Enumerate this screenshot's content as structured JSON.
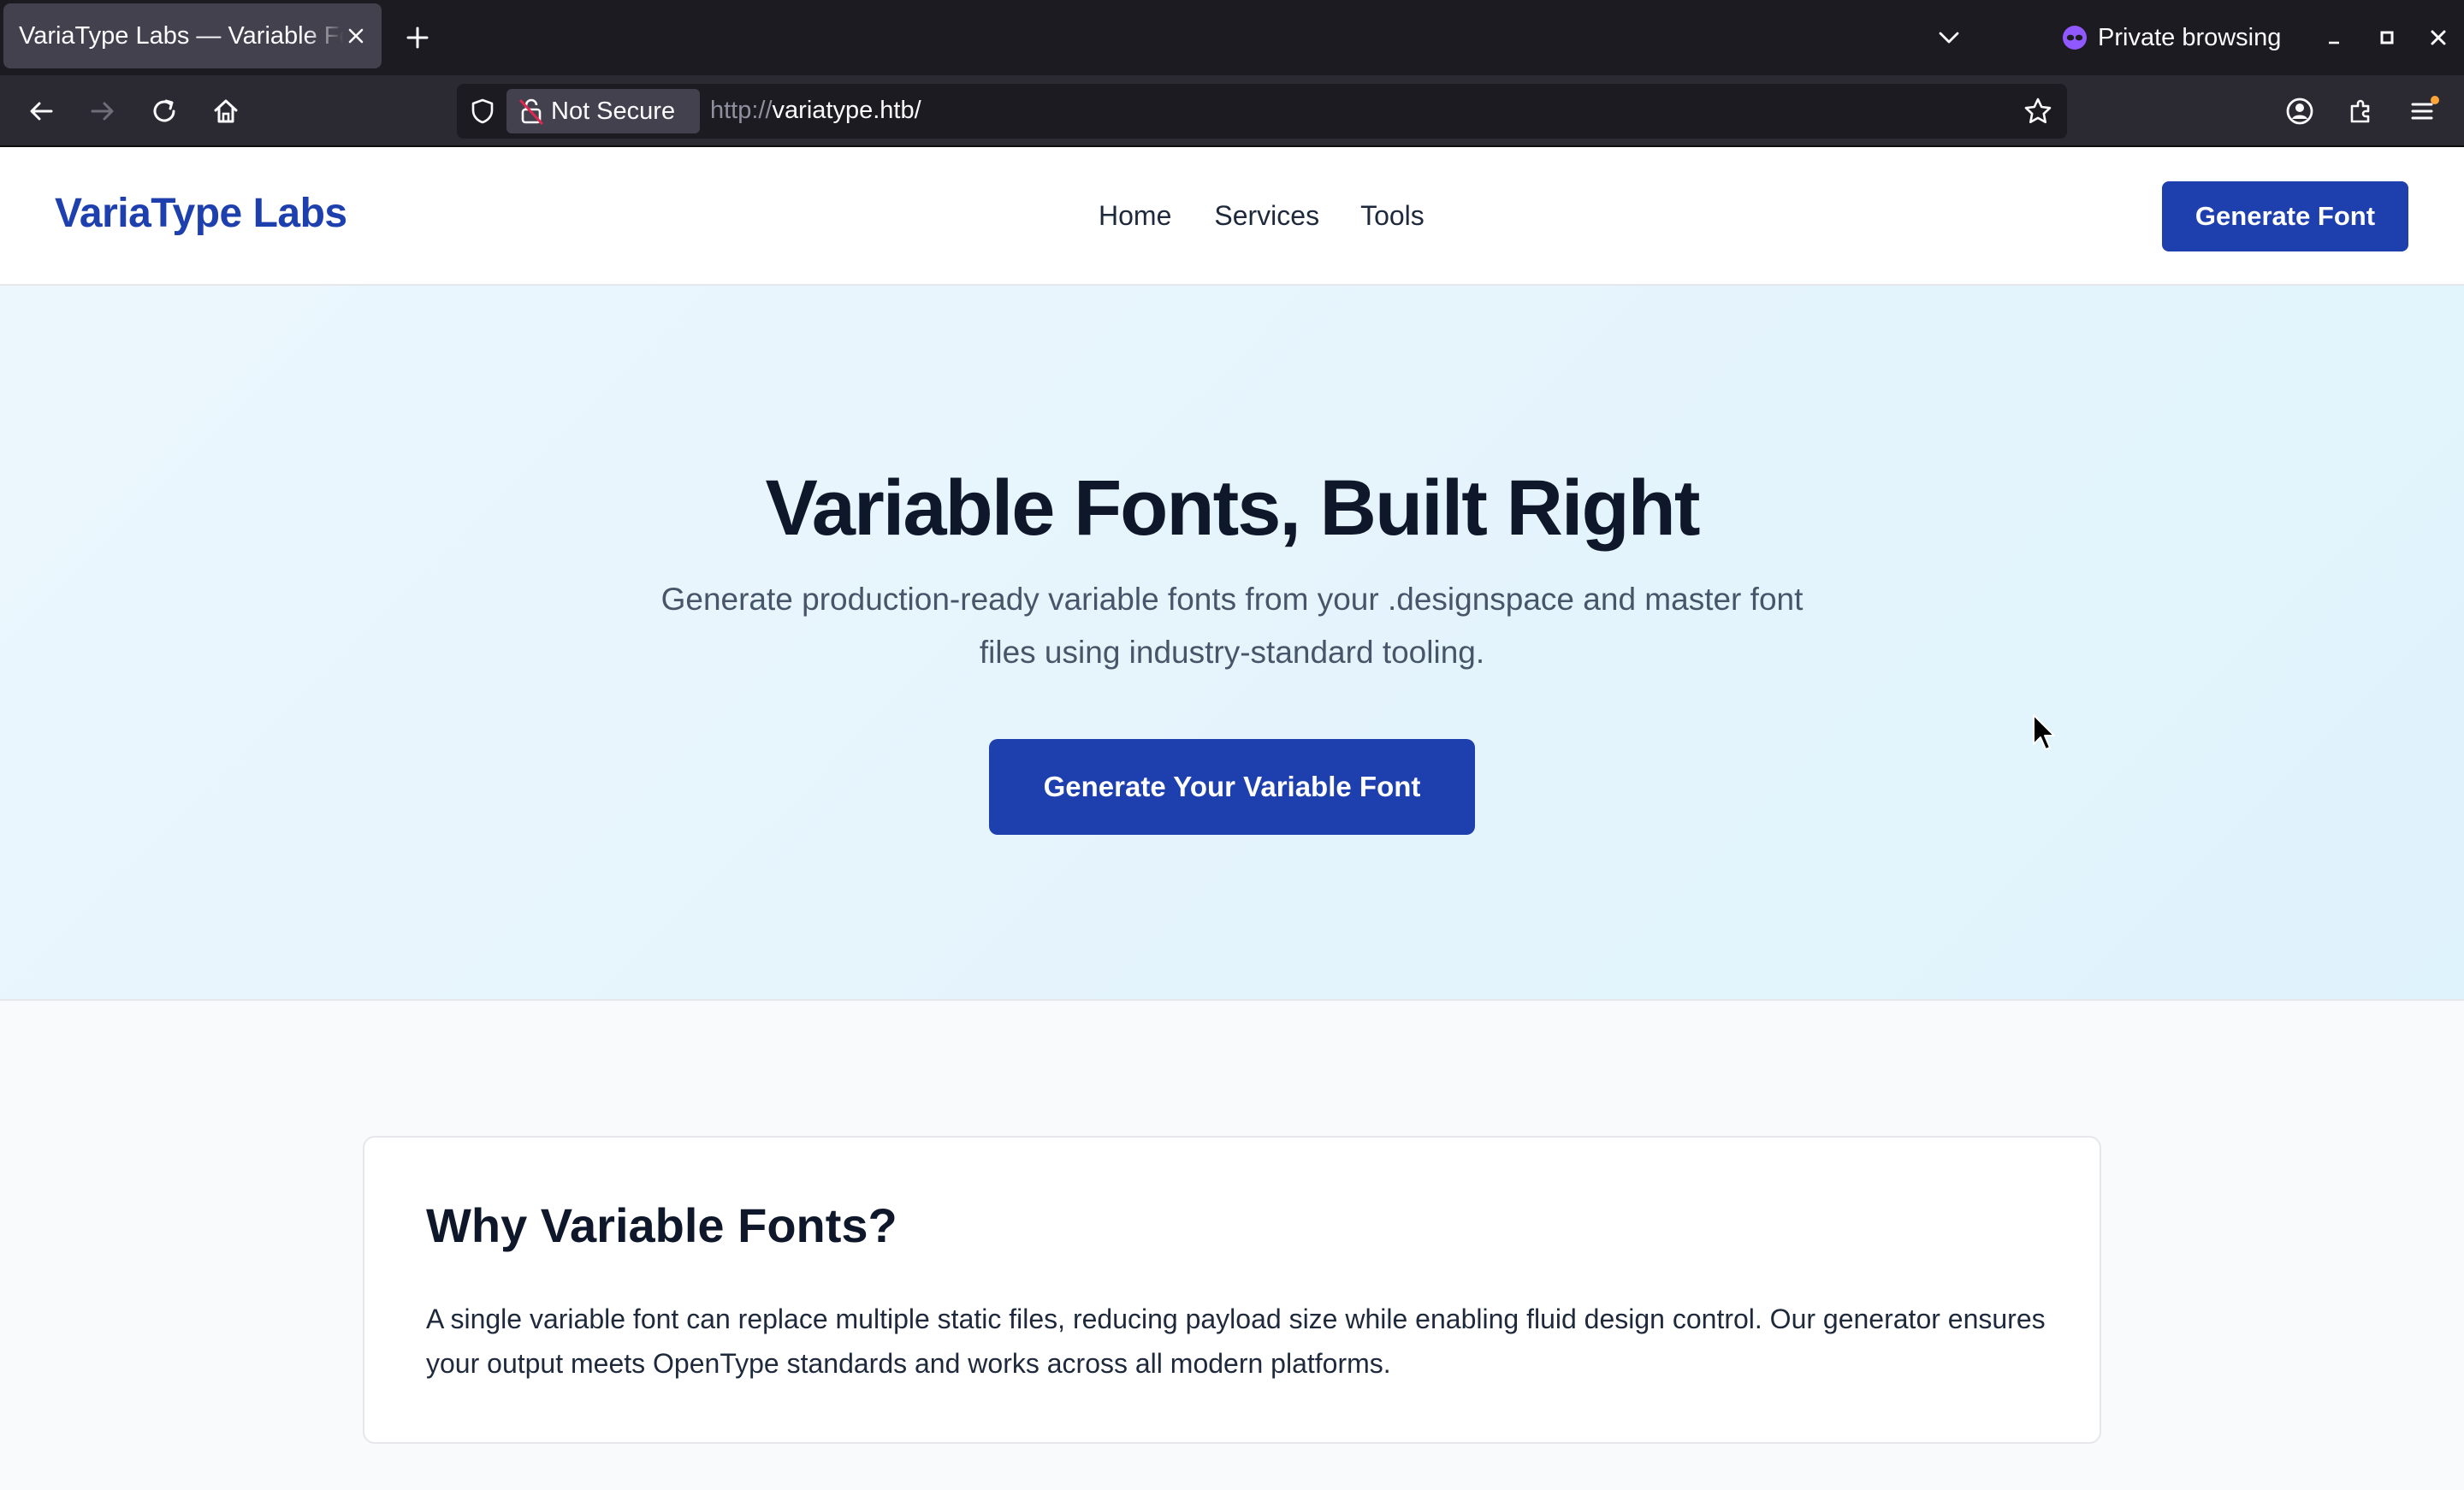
{
  "browser": {
    "tab": {
      "title": "VariaType Labs — Variable Fonts"
    },
    "private_label": "Private browsing",
    "security_label": "Not Secure",
    "url_scheme": "http://",
    "url_host": "variatype.htb/"
  },
  "header": {
    "brand": "VariaType Labs",
    "nav": {
      "home": "Home",
      "services": "Services",
      "tools": "Tools"
    },
    "cta": "Generate Font"
  },
  "hero": {
    "title": "Variable Fonts, Built Right",
    "subtitle": "Generate production-ready variable fonts from your .designspace and master font files using industry-standard tooling.",
    "cta": "Generate Your Variable Font"
  },
  "card": {
    "title": "Why Variable Fonts?",
    "body": "A single variable font can replace multiple static files, reducing payload size while enabling fluid design control. Our generator ensures your output meets OpenType standards and works across all modern platforms."
  },
  "colors": {
    "brand": "#1e40af",
    "hero_bg": "#e6f5fd",
    "chrome_dark": "#1c1b22"
  }
}
